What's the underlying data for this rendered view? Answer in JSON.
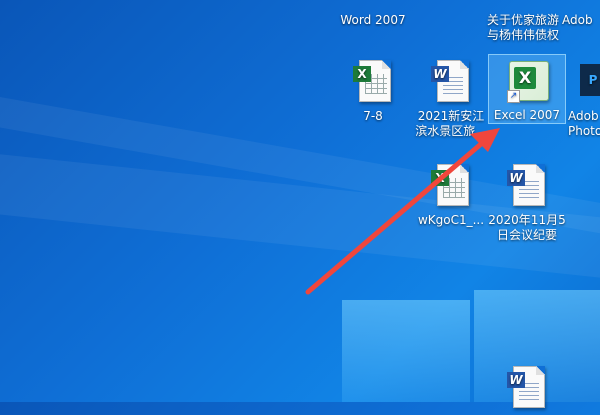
{
  "desktop": {
    "icons": {
      "word2007": {
        "label": "Word 2007",
        "icon": "word-app-icon"
      },
      "youjia": {
        "label": "关于优家旅游与杨伟伟债权",
        "icon": "word-doc-icon"
      },
      "adobe_top": {
        "label": "Adob",
        "icon": "adobe-app-icon"
      },
      "sheet78": {
        "label": "7-8",
        "icon": "excel-doc-icon"
      },
      "xinanjiang": {
        "label": "2021新安江滨水景区旅...",
        "icon": "word-doc-icon"
      },
      "excel2007": {
        "label": "Excel 2007",
        "icon": "excel-app-icon",
        "selected": true
      },
      "photoshop": {
        "label": "Adob Photo",
        "icon": "photoshop-app-icon"
      },
      "wkgoc": {
        "label": "wKgoC1_...",
        "icon": "excel-doc-icon"
      },
      "meeting": {
        "label": "2020年11月5日会议纪要",
        "icon": "word-doc-icon"
      },
      "bottom_doc": {
        "label": "",
        "icon": "word-doc-icon"
      }
    }
  },
  "annotation": {
    "color": "#f0463c"
  }
}
